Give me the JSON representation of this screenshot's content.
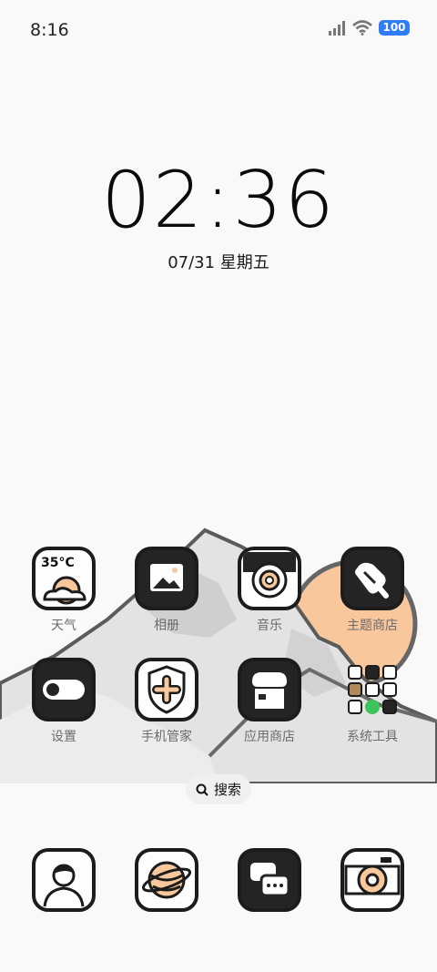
{
  "status_bar": {
    "time": "8:16",
    "battery": "100"
  },
  "lockclock": {
    "time": "02:36",
    "date": "07/31 星期五"
  },
  "weather_widget": {
    "temperature": "35°C"
  },
  "apps_row1": [
    {
      "label": "天气",
      "icon": "weather-icon"
    },
    {
      "label": "相册",
      "icon": "gallery-icon"
    },
    {
      "label": "音乐",
      "icon": "music-icon"
    },
    {
      "label": "主题商店",
      "icon": "theme-store-icon"
    }
  ],
  "apps_row2": [
    {
      "label": "设置",
      "icon": "settings-toggle-icon"
    },
    {
      "label": "手机管家",
      "icon": "phone-manager-icon"
    },
    {
      "label": "应用商店",
      "icon": "app-store-icon"
    },
    {
      "label": "系统工具",
      "icon": "folder-icon"
    }
  ],
  "search": {
    "label": "搜索"
  },
  "dock": [
    {
      "icon": "contacts-icon"
    },
    {
      "icon": "browser-icon"
    },
    {
      "icon": "messages-icon"
    },
    {
      "icon": "camera-icon"
    }
  ],
  "colors": {
    "accent_orange": "#f8c79c",
    "icon_dark": "#242424",
    "battery_blue": "#2f7df6"
  }
}
